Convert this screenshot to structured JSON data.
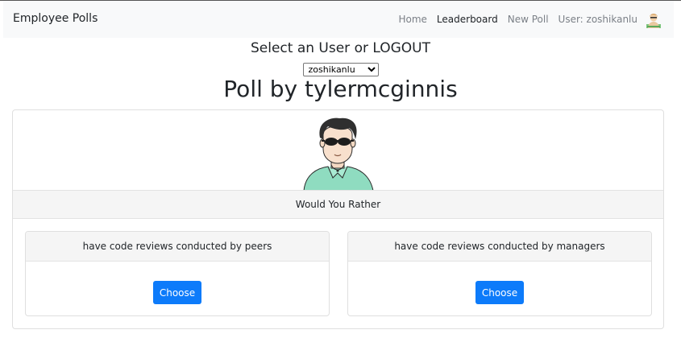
{
  "navbar": {
    "brand": "Employee Polls",
    "links": [
      {
        "label": "Home",
        "active": false
      },
      {
        "label": "Leaderboard",
        "active": true
      },
      {
        "label": "New Poll",
        "active": false
      }
    ],
    "user_label": "User: zoshikanlu",
    "avatar_icon": "user-avatar-icon"
  },
  "user_switcher": {
    "heading": "Select an User or LOGOUT",
    "selected_user": "zoshikanlu"
  },
  "poll": {
    "title": "Poll by tylermcginnis",
    "author_avatar_icon": "author-avatar-icon",
    "question": "Would You Rather",
    "options": [
      {
        "text": "have code reviews conducted by peers",
        "button_label": "Choose"
      },
      {
        "text": "have code reviews conducted by managers",
        "button_label": "Choose"
      }
    ]
  },
  "colors": {
    "navbar_bg": "#f8f9fa",
    "primary_button": "#0d7bfa",
    "card_header_bg": "#f5f5f5"
  }
}
